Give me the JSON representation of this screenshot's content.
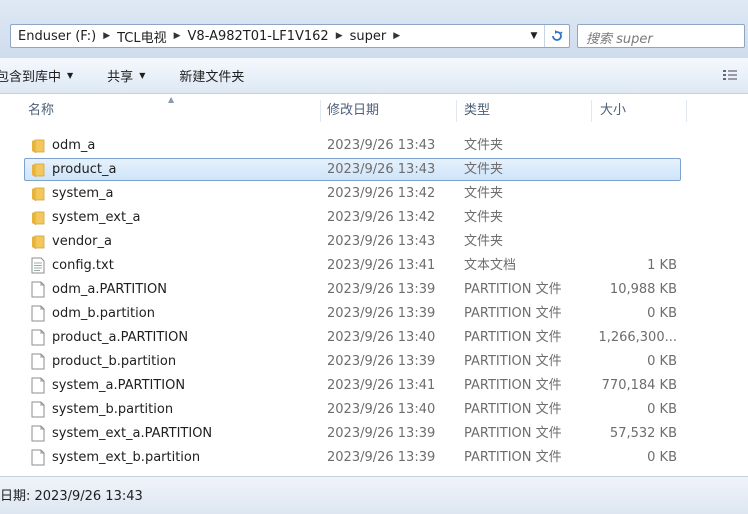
{
  "address": {
    "crumbs": [
      "Enduser (F:)",
      "TCL电视",
      "V8-A982T01-LF1V162",
      "super"
    ],
    "search_placeholder": "搜索 super"
  },
  "toolbar": {
    "include_library": "包含到库中",
    "share": "共享",
    "new_folder": "新建文件夹"
  },
  "columns": {
    "name": "名称",
    "date": "修改日期",
    "type": "类型",
    "size": "大小"
  },
  "files": [
    {
      "name": "odm_a",
      "date": "2023/9/26 13:43",
      "type": "文件夹",
      "size": "",
      "icon": "folder-icon",
      "selected": false
    },
    {
      "name": "product_a",
      "date": "2023/9/26 13:43",
      "type": "文件夹",
      "size": "",
      "icon": "folder-icon",
      "selected": true
    },
    {
      "name": "system_a",
      "date": "2023/9/26 13:42",
      "type": "文件夹",
      "size": "",
      "icon": "folder-icon",
      "selected": false
    },
    {
      "name": "system_ext_a",
      "date": "2023/9/26 13:42",
      "type": "文件夹",
      "size": "",
      "icon": "folder-icon",
      "selected": false
    },
    {
      "name": "vendor_a",
      "date": "2023/9/26 13:43",
      "type": "文件夹",
      "size": "",
      "icon": "folder-icon",
      "selected": false
    },
    {
      "name": "config.txt",
      "date": "2023/9/26 13:41",
      "type": "文本文档",
      "size": "1 KB",
      "icon": "text-file-icon",
      "selected": false
    },
    {
      "name": "odm_a.PARTITION",
      "date": "2023/9/26 13:39",
      "type": "PARTITION 文件",
      "size": "10,988 KB",
      "icon": "file-icon",
      "selected": false
    },
    {
      "name": "odm_b.partition",
      "date": "2023/9/26 13:39",
      "type": "PARTITION 文件",
      "size": "0 KB",
      "icon": "file-icon",
      "selected": false
    },
    {
      "name": "product_a.PARTITION",
      "date": "2023/9/26 13:40",
      "type": "PARTITION 文件",
      "size": "1,266,300...",
      "icon": "file-icon",
      "selected": false
    },
    {
      "name": "product_b.partition",
      "date": "2023/9/26 13:39",
      "type": "PARTITION 文件",
      "size": "0 KB",
      "icon": "file-icon",
      "selected": false
    },
    {
      "name": "system_a.PARTITION",
      "date": "2023/9/26 13:41",
      "type": "PARTITION 文件",
      "size": "770,184 KB",
      "icon": "file-icon",
      "selected": false
    },
    {
      "name": "system_b.partition",
      "date": "2023/9/26 13:40",
      "type": "PARTITION 文件",
      "size": "0 KB",
      "icon": "file-icon",
      "selected": false
    },
    {
      "name": "system_ext_a.PARTITION",
      "date": "2023/9/26 13:39",
      "type": "PARTITION 文件",
      "size": "57,532 KB",
      "icon": "file-icon",
      "selected": false
    },
    {
      "name": "system_ext_b.partition",
      "date": "2023/9/26 13:39",
      "type": "PARTITION 文件",
      "size": "0 KB",
      "icon": "file-icon",
      "selected": false
    }
  ],
  "status": {
    "modified": "日期: 2023/9/26 13:43"
  },
  "colors": {
    "selection": "#cfe4f9",
    "selection_border": "#7da2ce",
    "folder": "#e8b33a",
    "header_text": "#4c607a"
  }
}
